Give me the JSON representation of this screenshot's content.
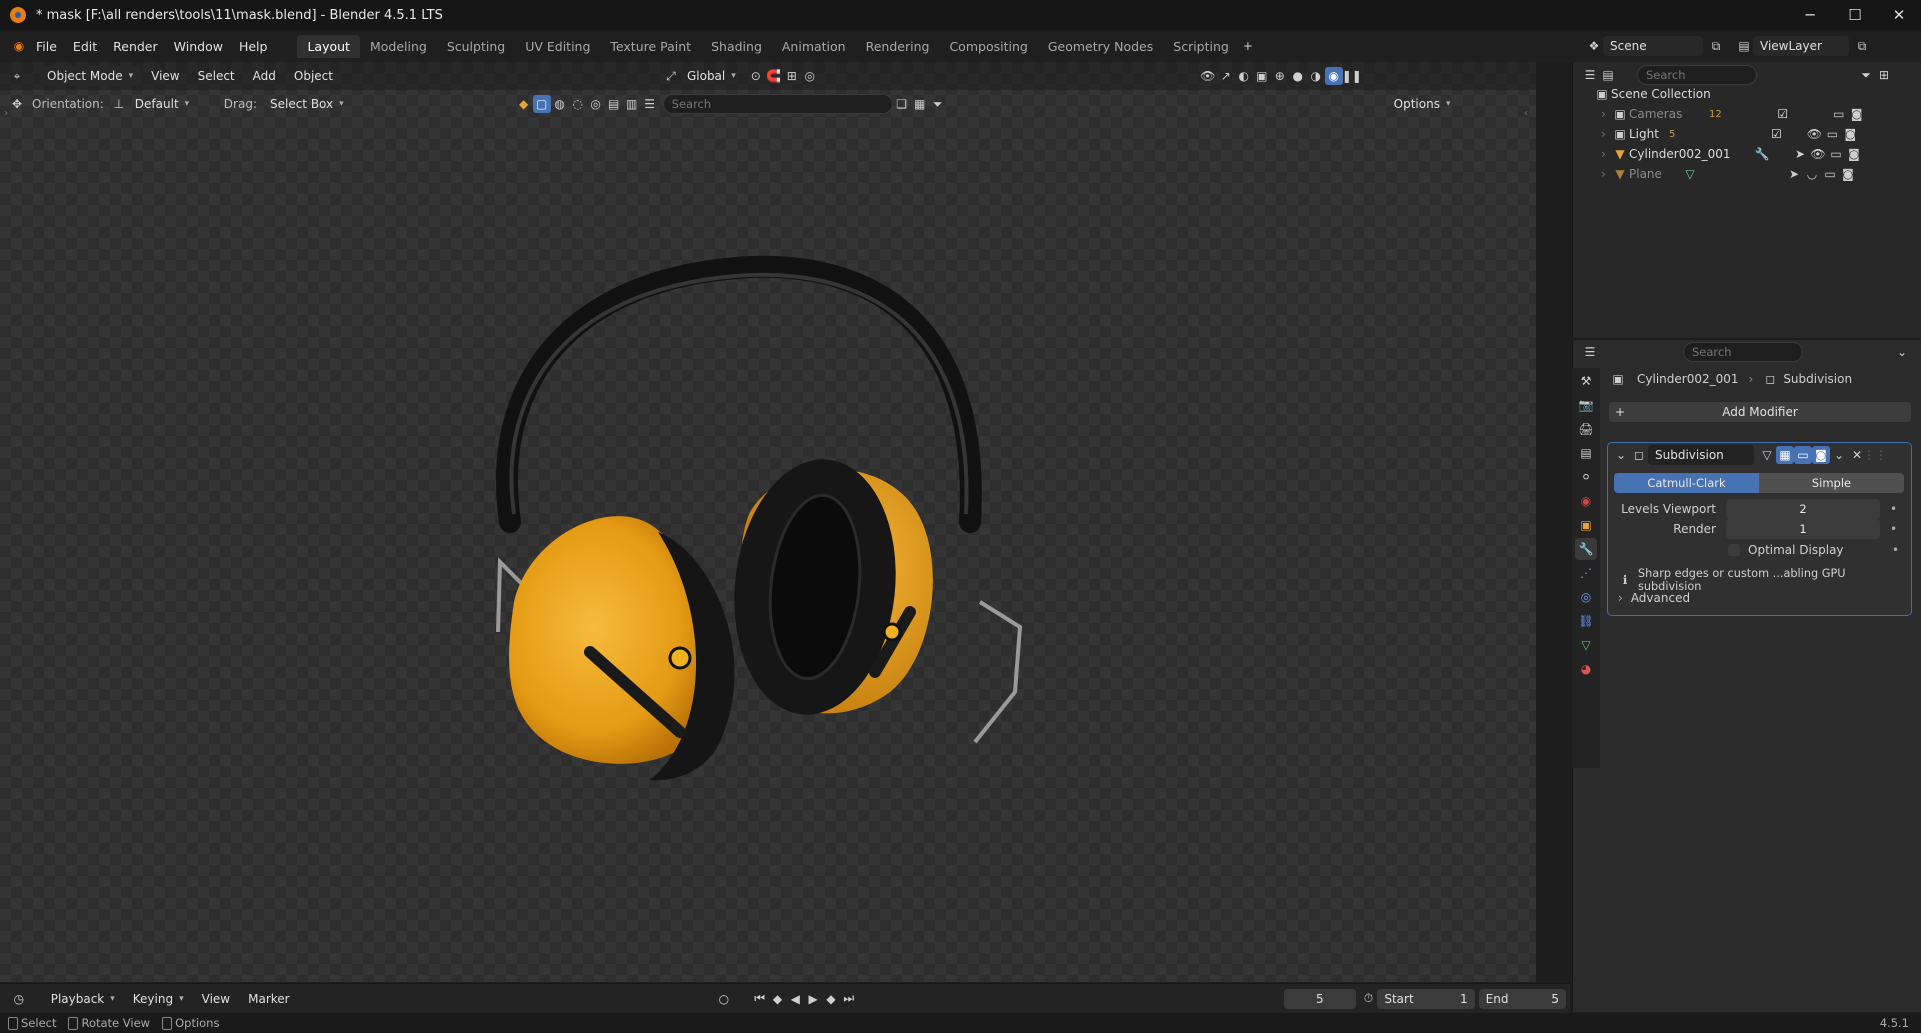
{
  "window": {
    "title": "* mask [F:\\all renders\\tools\\11\\mask.blend] - Blender 4.5.1 LTS",
    "minimize": "─",
    "maximize": "☐",
    "close": "✕"
  },
  "menu": [
    "File",
    "Edit",
    "Render",
    "Window",
    "Help"
  ],
  "workspaces": [
    "Layout",
    "Modeling",
    "Sculpting",
    "UV Editing",
    "Texture Paint",
    "Shading",
    "Animation",
    "Rendering",
    "Compositing",
    "Geometry Nodes",
    "Scripting"
  ],
  "active_workspace": "Layout",
  "scene": {
    "label": "Scene",
    "view_layer": "ViewLayer"
  },
  "viewport_header": {
    "mode": "Object Mode",
    "menus": [
      "View",
      "Select",
      "Add",
      "Object"
    ],
    "transform_orientation": "Global"
  },
  "tool_settings": {
    "orientation_label": "Orientation:",
    "orientation_value": "Default",
    "drag_label": "Drag:",
    "drag_value": "Select Box",
    "search_placeholder": "Search",
    "options": "Options"
  },
  "outliner": {
    "search_placeholder": "Search",
    "root": "Scene Collection",
    "items": [
      {
        "name": "Cameras",
        "badge": "12",
        "dim": true
      },
      {
        "name": "Light",
        "badge": "5",
        "dim": false
      },
      {
        "name": "Cylinder002_001",
        "badge": "",
        "dim": false
      },
      {
        "name": "Plane",
        "badge": "",
        "dim": true
      }
    ]
  },
  "properties": {
    "search_placeholder": "Search",
    "breadcrumb_object": "Cylinder002_001",
    "breadcrumb_modifier": "Subdivision",
    "add_modifier": "Add Modifier",
    "modifier": {
      "name": "Subdivision",
      "mode_catmull": "Catmull-Clark",
      "mode_simple": "Simple",
      "active_mode": "Catmull-Clark",
      "levels_viewport_label": "Levels Viewport",
      "levels_viewport": "2",
      "render_label": "Render",
      "render": "1",
      "optimal_display_label": "Optimal Display",
      "optimal_display": false,
      "info": "Sharp edges or custom ...abling GPU subdivision",
      "advanced": "Advanced"
    }
  },
  "timeline": {
    "menus": [
      "Playback",
      "Keying",
      "View",
      "Marker"
    ],
    "current_frame": "5",
    "start_label": "Start",
    "start": "1",
    "end_label": "End",
    "end": "5"
  },
  "statusbar": {
    "select": "Select",
    "rotate": "Rotate View",
    "options": "Options",
    "version": "4.5.1"
  },
  "colors": {
    "accent": "#4772b3",
    "earcup": "#e9a21d",
    "band": "#1b1b1b"
  }
}
